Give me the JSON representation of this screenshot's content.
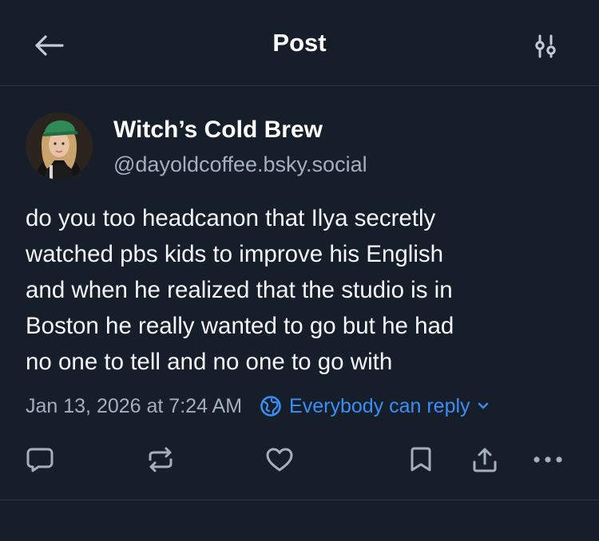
{
  "header": {
    "title": "Post",
    "back_icon": "arrow-left-icon",
    "filter_icon": "sliders-icon"
  },
  "author": {
    "display_name": "Witch’s Cold Brew",
    "handle": "@dayoldcoffee.bsky.social",
    "avatar_icon": "profile-photo"
  },
  "post": {
    "lines": [
      "do you too headcanon that Ilya secretly",
      "watched pbs kids to improve his English",
      "and when he realized that the studio is in",
      "Boston he really wanted to go but he had",
      "no one to tell and no one to go with"
    ],
    "timestamp": "Jan 13, 2026 at 7:24 AM",
    "reply_setting": "Everybody can reply"
  },
  "actions": {
    "icons": [
      "reply-icon",
      "repost-icon",
      "like-icon",
      "bookmark-icon",
      "share-icon",
      "more-icon"
    ]
  },
  "colors": {
    "background": "#161e2a",
    "text": "#ffffff",
    "muted": "#a3afbf",
    "accent": "#3a8ef6",
    "divider": "#2c3645"
  }
}
